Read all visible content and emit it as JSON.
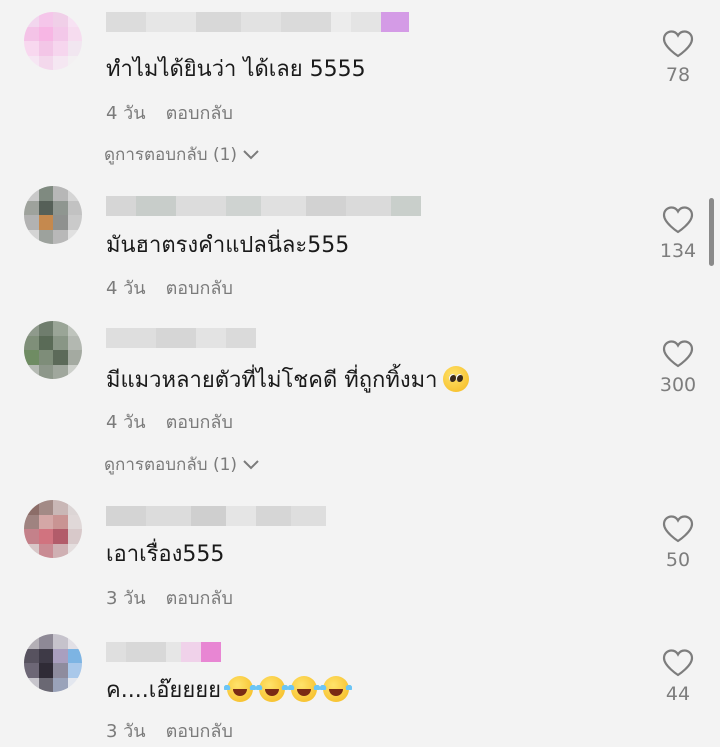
{
  "comments": [
    {
      "text": "ทำไมได้ยินว่า ได้เลย 5555",
      "time": "4 วัน",
      "reply_label": "ตอบกลับ",
      "view_replies": "ดูการตอบกลับ (1)",
      "likes": "78"
    },
    {
      "text": "มันฮาตรงคำแปลนี่ละ555",
      "time": "4 วัน",
      "reply_label": "ตอบกลับ",
      "likes": "134"
    },
    {
      "text": "มีแมวหลายตัวที่ไม่โชคดี ที่ถูกทิ้งมา",
      "emoji": [
        "pleading-face"
      ],
      "time": "4 วัน",
      "reply_label": "ตอบกลับ",
      "view_replies": "ดูการตอบกลับ (1)",
      "likes": "300"
    },
    {
      "text": "เอาเรื่อง555",
      "time": "3 วัน",
      "reply_label": "ตอบกลับ",
      "likes": "50"
    },
    {
      "text": "ค....เอ๊ยยยย",
      "emoji": [
        "tears-of-joy",
        "tears-of-joy",
        "tears-of-joy",
        "tears-of-joy"
      ],
      "time": "3 วัน",
      "reply_label": "ตอบกลับ",
      "likes": "44"
    }
  ],
  "icons": {
    "like": "heart-outline-icon",
    "expand": "chevron-down-icon"
  },
  "colors": {
    "background": "#f3f3f3",
    "secondary_text": "#7b7b7b",
    "primary_text": "#1a1a1a"
  }
}
